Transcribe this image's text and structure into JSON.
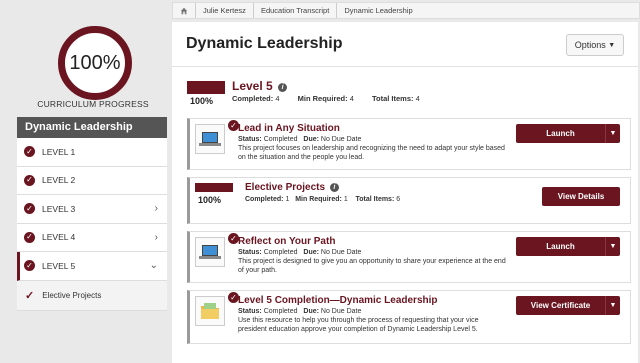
{
  "progress": {
    "value": "100%",
    "label": "CURRICULUM PROGRESS",
    "fraction": 1.0
  },
  "sidebar": {
    "title": "Dynamic Leadership",
    "items": [
      {
        "label": "LEVEL 1"
      },
      {
        "label": "LEVEL 2"
      },
      {
        "label": "LEVEL 3"
      },
      {
        "label": "LEVEL 4"
      },
      {
        "label": "LEVEL 5"
      },
      {
        "label": "Elective Projects"
      }
    ]
  },
  "breadcrumb": [
    "Julie Kertesz",
    "Education Transcript",
    "Dynamic Leadership"
  ],
  "header": {
    "title": "Dynamic Leadership",
    "options_label": "Options"
  },
  "level": {
    "title": "Level 5",
    "percent": "100%",
    "completed_label": "Completed:",
    "completed": "4",
    "min_label": "Min Required:",
    "min": "4",
    "total_label": "Total Items:",
    "total": "4"
  },
  "cards": [
    {
      "title": "Lead in Any Situation",
      "status_label": "Status:",
      "status": "Completed",
      "due_label": "Due:",
      "due": "No Due Date",
      "desc": "This project focuses on leadership and recognizing the need to adapt your style based on the situation and the people you lead.",
      "button": "Launch"
    },
    {
      "title": "Elective Projects",
      "percent": "100%",
      "completed_label": "Completed:",
      "completed": "1",
      "min_label": "Min Required:",
      "min": "1",
      "total_label": "Total Items:",
      "total": "6",
      "button": "View Details"
    },
    {
      "title": "Reflect on Your Path",
      "status_label": "Status:",
      "status": "Completed",
      "due_label": "Due:",
      "due": "No Due Date",
      "desc": "This project is designed to give you an opportunity to share your experience at the end of your path.",
      "button": "Launch"
    },
    {
      "title": "Level 5 Completion—Dynamic Leadership",
      "status_label": "Status:",
      "status": "Completed",
      "due_label": "Due:",
      "due": "No Due Date",
      "desc": "Use this resource to help you through the process of requesting that your vice president education approve your completion of Dynamic Leadership Level 5.",
      "button": "View Certificate"
    }
  ],
  "colors": {
    "accent": "#6a1520",
    "sidebar_header": "#555555"
  }
}
